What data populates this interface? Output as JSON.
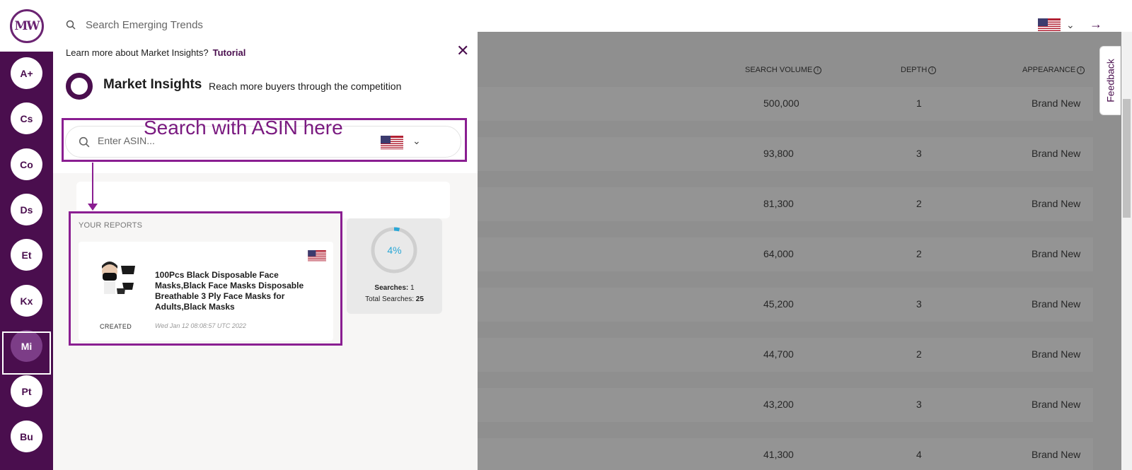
{
  "app": {
    "logo_text": "MW"
  },
  "rail": {
    "items": [
      {
        "label": "A+",
        "active": false
      },
      {
        "label": "Cs",
        "active": false
      },
      {
        "label": "Co",
        "active": false
      },
      {
        "label": "Ds",
        "active": false
      },
      {
        "label": "Et",
        "active": false
      },
      {
        "label": "Kx",
        "active": false
      },
      {
        "label": "Mi",
        "active": true
      },
      {
        "label": "Pt",
        "active": false
      },
      {
        "label": "Bu",
        "active": false
      }
    ]
  },
  "topbar": {
    "search_placeholder": "Search Emerging Trends",
    "flag_icon": "us-flag-icon",
    "logout_icon": "arrow-right-icon"
  },
  "panel": {
    "learn_text": "Learn more about Market Insights?",
    "tutorial_link": "Tutorial",
    "title": "Market Insights",
    "subtitle": "Reach more buyers through the competition",
    "asin_placeholder": "Enter ASIN...",
    "annotation": "Search with ASIN here",
    "reports_label": "YOUR REPORTS",
    "report": {
      "title": "100Pcs Black Disposable Face Masks,Black Face Masks Disposable Breathable 3 Ply Face Masks for Adults,Black Masks",
      "created_label": "CREATED",
      "created_date": "Wed Jan 12 08:08:57 UTC 2022"
    },
    "stats": {
      "progress_percent": 4,
      "progress_label": "4%",
      "searches_label": "Searches:",
      "searches_value": "1",
      "total_label": "Total Searches:",
      "total_value": "25"
    }
  },
  "table": {
    "headers": {
      "search_volume": "SEARCH VOLUME",
      "depth": "DEPTH",
      "appearance": "APPEARANCE"
    },
    "rows": [
      {
        "volume": "500,000",
        "depth": "1",
        "appearance": "Brand New"
      },
      {
        "volume": "93,800",
        "depth": "3",
        "appearance": "Brand New"
      },
      {
        "volume": "81,300",
        "depth": "2",
        "appearance": "Brand New"
      },
      {
        "volume": "64,000",
        "depth": "2",
        "appearance": "Brand New"
      },
      {
        "volume": "45,200",
        "depth": "3",
        "appearance": "Brand New"
      },
      {
        "volume": "44,700",
        "depth": "2",
        "appearance": "Brand New"
      },
      {
        "volume": "43,200",
        "depth": "3",
        "appearance": "Brand New"
      },
      {
        "volume": "41,300",
        "depth": "4",
        "appearance": "Brand New"
      }
    ]
  },
  "feedback_label": "Feedback",
  "colors": {
    "brand": "#4a0e4e",
    "annotation": "#8a1e91",
    "progress": "#2aa7d6"
  }
}
